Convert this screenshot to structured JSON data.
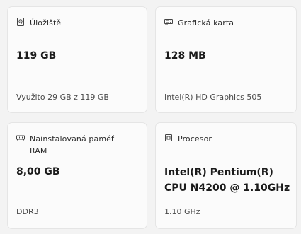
{
  "cards": [
    {
      "icon": "storage-icon",
      "label": "Úložiště",
      "value": "119 GB",
      "detail": "Využito 29 GB z 119 GB"
    },
    {
      "icon": "graphics-card-icon",
      "label": "Grafická karta",
      "value": "128 MB",
      "detail": "Intel(R) HD Graphics 505"
    },
    {
      "icon": "memory-icon",
      "label": "Nainstalovaná paměť RAM",
      "value": "8,00 GB",
      "detail": "DDR3"
    },
    {
      "icon": "processor-icon",
      "label": "Procesor",
      "value": "Intel(R) Pentium(R) CPU N4200 @ 1.10GHz",
      "detail": "1.10 GHz"
    }
  ]
}
